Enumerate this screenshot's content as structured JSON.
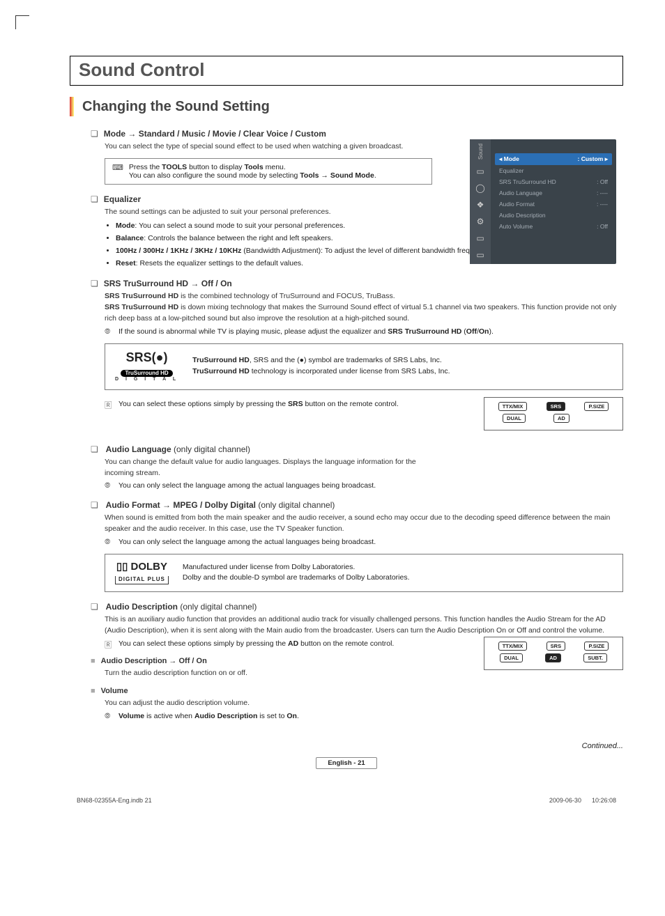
{
  "title": "Sound Control",
  "section": "Changing the Sound Setting",
  "mode": {
    "heading": "Mode → Standard / Music / Movie / Clear Voice / Custom",
    "text": "You can select the type of special sound effect to be used when watching a given broadcast.",
    "tip1": "Press the TOOLS button to display Tools menu.",
    "tip2": "You can also configure the sound mode by selecting Tools → Sound Mode."
  },
  "equalizer": {
    "heading": "Equalizer",
    "text": "The sound settings can be adjusted to suit your personal preferences.",
    "b1a": "Mode",
    "b1b": ": You can select a sound mode to suit your personal preferences.",
    "b2a": "Balance",
    "b2b": ": Controls the balance between the right and left speakers.",
    "b3a": "100Hz / 300Hz / 1KHz / 3KHz / 10KHz",
    "b3b": " (Bandwidth Adjustment): To adjust the level of different bandwidth frequencies",
    "b4a": "Reset",
    "b4b": ": Resets the equalizer settings to the default values."
  },
  "srs": {
    "heading": "SRS TruSurround HD → Off / On",
    "p1a": "SRS TruSurround HD",
    "p1b": " is the combined technology of TruSurround and FOCUS, TruBass.",
    "p2a": "SRS TruSurround HD",
    "p2b": " is down mixing technology that makes the Surround Sound effect of virtual 5.1 channel via two speakers. This function provide not only rich deep bass at a low-pitched sound but also improve the resolution at a high-pitched sound.",
    "note": "If the sound is abnormal while TV is playing music, please adjust the equalizer and SRS TruSurround HD (Off/On).",
    "logo_top": "SRS(●)",
    "logo_mid": "TruSurround HD",
    "logo_bot": "D I G I T A L",
    "legal1": "TruSurround HD, SRS and the (●) symbol are trademarks of SRS Labs, Inc.",
    "legal2": "TruSurround HD technology is incorporated under license from SRS Labs, Inc.",
    "remote_note": "You can select these options simply by pressing the SRS button on the remote control."
  },
  "audiolang": {
    "heading_a": "Audio Language",
    "heading_b": " (only digital channel)",
    "text": "You can change the default value for audio languages. Displays the language information for the incoming stream.",
    "note": "You can only select the language among the actual languages being broadcast."
  },
  "audiofmt": {
    "heading_a": "Audio Format → MPEG / Dolby Digital",
    "heading_b": " (only digital channel)",
    "text": "When sound is emitted from both the main speaker and the audio receiver, a sound echo may occur due to the decoding speed difference between the main speaker and the audio receiver. In this case, use the TV Speaker function.",
    "note": "You can only select the language among the actual languages being broadcast.",
    "dolby_top": "▯▯ DOLBY",
    "dolby_sub": "DIGITAL PLUS",
    "legal1": "Manufactured under license from Dolby Laboratories.",
    "legal2": "Dolby and the double-D symbol are trademarks of Dolby Laboratories."
  },
  "audiodesc": {
    "heading_a": "Audio Description",
    "heading_b": " (only digital channel)",
    "text": "This is an auxiliary audio function that provides an additional audio track for visually challenged persons. This function handles the Audio Stream for the AD (Audio Description), when it is sent along with the Main audio from the broadcaster. Users can turn the Audio Description On or Off and control the volume.",
    "remote_note": "You can select these options simply by pressing the AD button on the remote control.",
    "s1_head": "Audio Description → Off / On",
    "s1_text": "Turn the audio description function on or off.",
    "s2_head": "Volume",
    "s2_text": "You can adjust the audio description volume.",
    "s2_note": "Volume is active when Audio Description is set to On."
  },
  "osd": {
    "tab": "Sound",
    "rows": [
      {
        "l": "Mode",
        "r": ": Custom",
        "arrow": "▸",
        "sel": true
      },
      {
        "l": "Equalizer",
        "r": ""
      },
      {
        "l": "SRS TruSurround HD",
        "r": ": Off"
      },
      {
        "l": "Audio Language",
        "r": ": ----"
      },
      {
        "l": "Audio Format",
        "r": ": ----"
      },
      {
        "l": "Audio Description",
        "r": ""
      },
      {
        "l": "Auto Volume",
        "r": ": Off"
      }
    ]
  },
  "remote1": {
    "r1": [
      "TTX/MIX",
      "SRS",
      "P.SIZE"
    ],
    "r2": [
      "DUAL",
      "AD",
      " "
    ]
  },
  "remote2": {
    "r1": [
      "TTX/MIX",
      "SRS",
      "P.SIZE"
    ],
    "r2": [
      "DUAL",
      "AD",
      "SUBT."
    ]
  },
  "continued": "Continued...",
  "footer_center": "English - 21",
  "footer_left": "BN68-02355A-Eng.indb   21",
  "footer_right": "2009-06-30      10:26:08"
}
